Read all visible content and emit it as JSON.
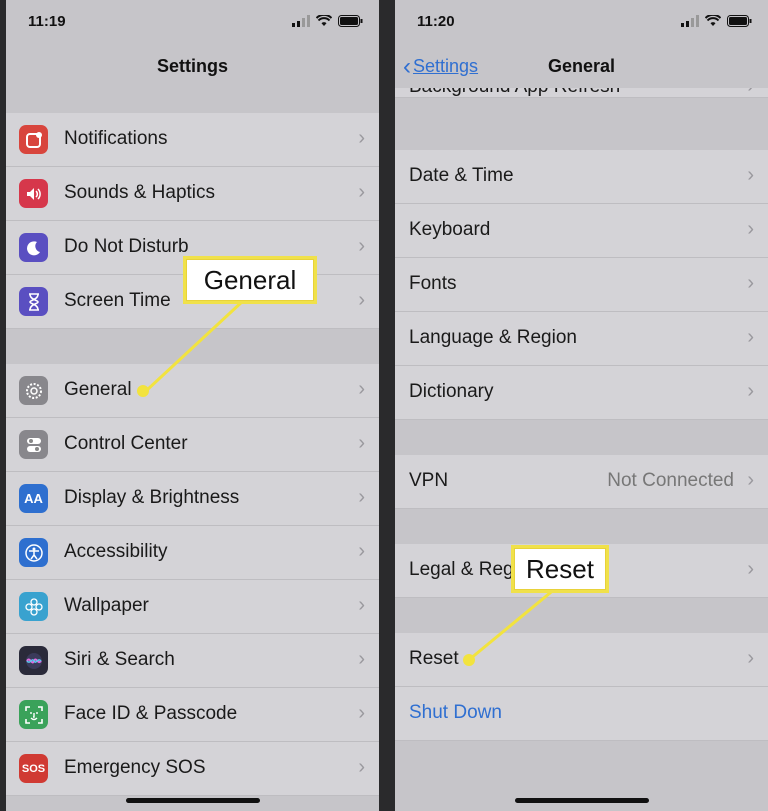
{
  "colors": {
    "background": "#c6c5c9",
    "row": "#d4d3d7",
    "accent_blue": "#2f6fd1",
    "callout_border": "#f0e14a"
  },
  "left": {
    "time": "11:19",
    "title": "Settings",
    "items": [
      {
        "label": "Notifications",
        "icon": "notifications-icon",
        "color": "#d8453d"
      },
      {
        "label": "Sounds & Haptics",
        "icon": "speaker-icon",
        "color": "#d6374b"
      },
      {
        "label": "Do Not Disturb",
        "icon": "moon-icon",
        "color": "#5a4fc1"
      },
      {
        "label": "Screen Time",
        "icon": "hourglass-icon",
        "color": "#5a4fc1"
      },
      {
        "label": "General",
        "icon": "gear-icon",
        "color": "#88878c"
      },
      {
        "label": "Control Center",
        "icon": "toggles-icon",
        "color": "#88878c"
      },
      {
        "label": "Display & Brightness",
        "icon": "aa-icon",
        "glyph": "AA",
        "color": "#2e6fcf"
      },
      {
        "label": "Accessibility",
        "icon": "accessibility-icon",
        "color": "#2e6fcf"
      },
      {
        "label": "Wallpaper",
        "icon": "flower-icon",
        "color": "#39a2cf"
      },
      {
        "label": "Siri & Search",
        "icon": "siri-icon",
        "color": "#2a2a3a"
      },
      {
        "label": "Face ID & Passcode",
        "icon": "faceid-icon",
        "color": "#3aa25a"
      },
      {
        "label": "Emergency SOS",
        "icon": "sos-icon",
        "glyph": "SOS",
        "color": "#d03a33"
      }
    ],
    "callout": "General"
  },
  "right": {
    "time": "11:20",
    "back_label": "Settings",
    "title": "General",
    "top_partial": "Background App Refresh",
    "items": [
      {
        "label": "Date & Time"
      },
      {
        "label": "Keyboard"
      },
      {
        "label": "Fonts"
      },
      {
        "label": "Language & Region"
      },
      {
        "label": "Dictionary"
      },
      {
        "label": "VPN",
        "value": "Not Connected"
      },
      {
        "label": "Legal & Regulatory"
      },
      {
        "label": "Reset"
      },
      {
        "label": "Shut Down"
      }
    ],
    "callout": "Reset"
  }
}
